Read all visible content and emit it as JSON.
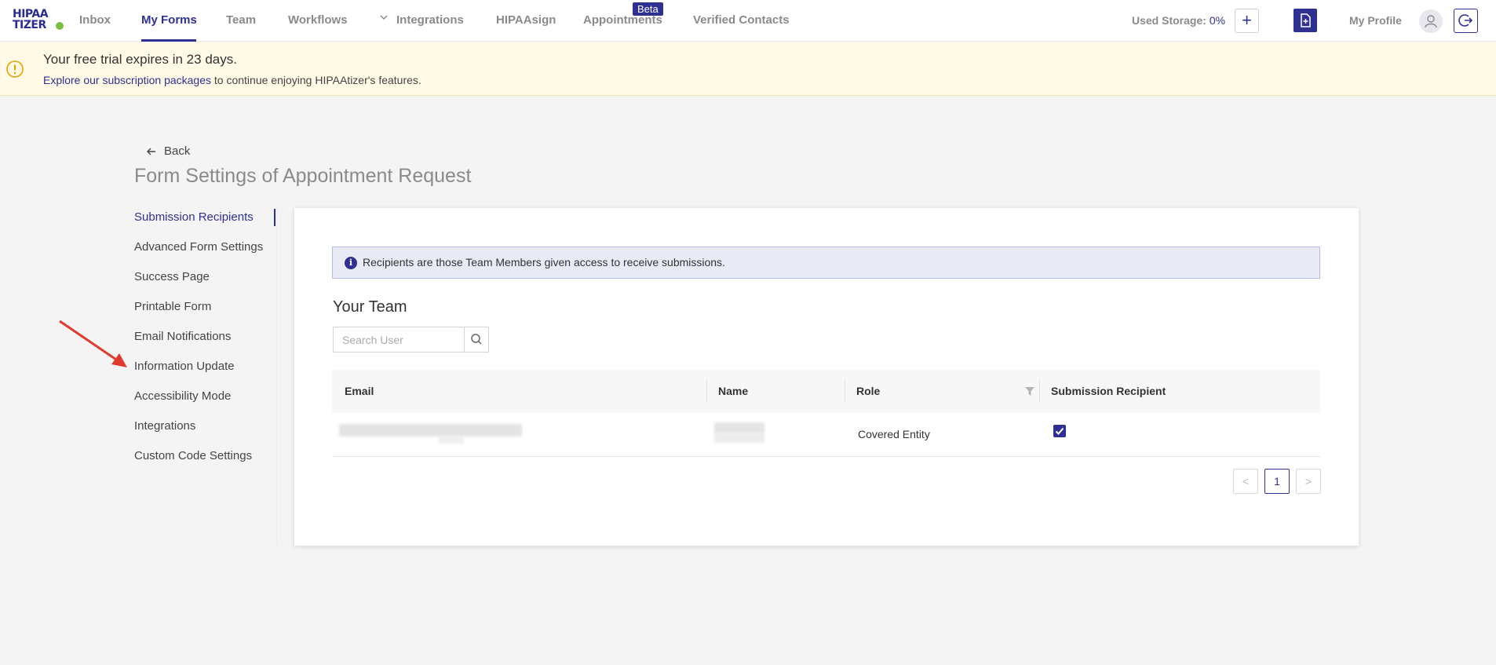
{
  "nav": {
    "logo_line1": "HIPAA",
    "logo_line2": "TIZER",
    "items": [
      "Inbox",
      "My Forms",
      "Team",
      "Workflows",
      "Integrations",
      "HIPAAsign",
      "Appointments",
      "Verified Contacts"
    ],
    "beta_badge": "Beta",
    "storage_label": "Used Storage:",
    "storage_value": "0%",
    "add_label": "+",
    "profile_label": "My Profile"
  },
  "banner": {
    "title": "Your free trial expires in 23 days.",
    "link_text": "Explore our subscription packages",
    "rest_text": " to continue enjoying HIPAAtizer's features."
  },
  "page": {
    "back_label": "Back",
    "title": "Form Settings of Appointment Request"
  },
  "menu": {
    "items": [
      "Submission Recipients",
      "Advanced Form Settings",
      "Success Page",
      "Printable Form",
      "Email Notifications",
      "Information Update",
      "Accessibility Mode",
      "Integrations",
      "Custom Code Settings"
    ]
  },
  "content": {
    "info_icon": "i",
    "info_text": "Recipients are those Team Members given access to receive submissions.",
    "team_title": "Your Team",
    "search_placeholder": "Search User",
    "table": {
      "headers": [
        "Email",
        "Name",
        "Role",
        "Submission Recipient"
      ],
      "rows": [
        {
          "role": "Covered Entity",
          "recipient_checked": true
        }
      ]
    },
    "pagination": {
      "prev": "<",
      "page": "1",
      "next": ">"
    }
  },
  "colors": {
    "brand": "#2e3192",
    "banner_bg": "#fff9e5",
    "warning": "#e2a400",
    "annotation": "#e03a2e"
  }
}
